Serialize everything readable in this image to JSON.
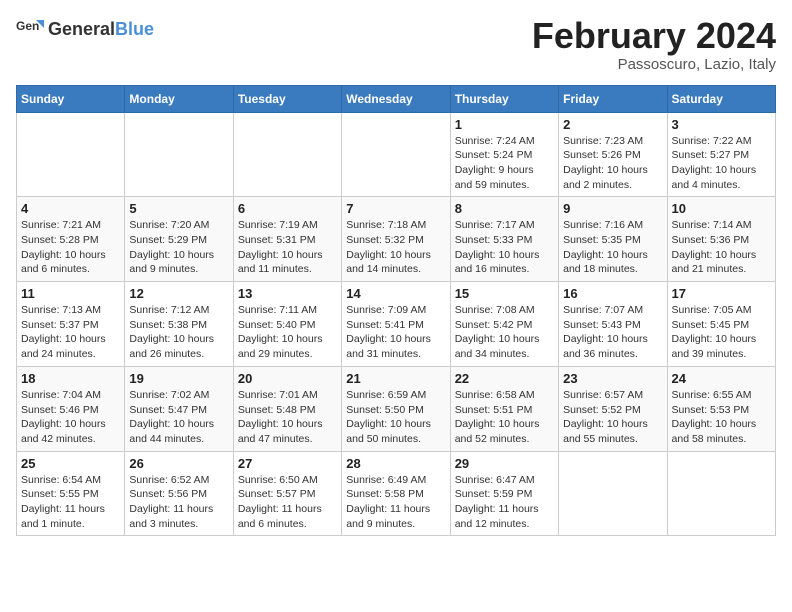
{
  "header": {
    "logo_line1": "General",
    "logo_line2": "Blue",
    "month_title": "February 2024",
    "subtitle": "Passoscuro, Lazio, Italy"
  },
  "weekdays": [
    "Sunday",
    "Monday",
    "Tuesday",
    "Wednesday",
    "Thursday",
    "Friday",
    "Saturday"
  ],
  "weeks": [
    [
      {
        "day": "",
        "info": ""
      },
      {
        "day": "",
        "info": ""
      },
      {
        "day": "",
        "info": ""
      },
      {
        "day": "",
        "info": ""
      },
      {
        "day": "1",
        "info": "Sunrise: 7:24 AM\nSunset: 5:24 PM\nDaylight: 9 hours\nand 59 minutes."
      },
      {
        "day": "2",
        "info": "Sunrise: 7:23 AM\nSunset: 5:26 PM\nDaylight: 10 hours\nand 2 minutes."
      },
      {
        "day": "3",
        "info": "Sunrise: 7:22 AM\nSunset: 5:27 PM\nDaylight: 10 hours\nand 4 minutes."
      }
    ],
    [
      {
        "day": "4",
        "info": "Sunrise: 7:21 AM\nSunset: 5:28 PM\nDaylight: 10 hours\nand 6 minutes."
      },
      {
        "day": "5",
        "info": "Sunrise: 7:20 AM\nSunset: 5:29 PM\nDaylight: 10 hours\nand 9 minutes."
      },
      {
        "day": "6",
        "info": "Sunrise: 7:19 AM\nSunset: 5:31 PM\nDaylight: 10 hours\nand 11 minutes."
      },
      {
        "day": "7",
        "info": "Sunrise: 7:18 AM\nSunset: 5:32 PM\nDaylight: 10 hours\nand 14 minutes."
      },
      {
        "day": "8",
        "info": "Sunrise: 7:17 AM\nSunset: 5:33 PM\nDaylight: 10 hours\nand 16 minutes."
      },
      {
        "day": "9",
        "info": "Sunrise: 7:16 AM\nSunset: 5:35 PM\nDaylight: 10 hours\nand 18 minutes."
      },
      {
        "day": "10",
        "info": "Sunrise: 7:14 AM\nSunset: 5:36 PM\nDaylight: 10 hours\nand 21 minutes."
      }
    ],
    [
      {
        "day": "11",
        "info": "Sunrise: 7:13 AM\nSunset: 5:37 PM\nDaylight: 10 hours\nand 24 minutes."
      },
      {
        "day": "12",
        "info": "Sunrise: 7:12 AM\nSunset: 5:38 PM\nDaylight: 10 hours\nand 26 minutes."
      },
      {
        "day": "13",
        "info": "Sunrise: 7:11 AM\nSunset: 5:40 PM\nDaylight: 10 hours\nand 29 minutes."
      },
      {
        "day": "14",
        "info": "Sunrise: 7:09 AM\nSunset: 5:41 PM\nDaylight: 10 hours\nand 31 minutes."
      },
      {
        "day": "15",
        "info": "Sunrise: 7:08 AM\nSunset: 5:42 PM\nDaylight: 10 hours\nand 34 minutes."
      },
      {
        "day": "16",
        "info": "Sunrise: 7:07 AM\nSunset: 5:43 PM\nDaylight: 10 hours\nand 36 minutes."
      },
      {
        "day": "17",
        "info": "Sunrise: 7:05 AM\nSunset: 5:45 PM\nDaylight: 10 hours\nand 39 minutes."
      }
    ],
    [
      {
        "day": "18",
        "info": "Sunrise: 7:04 AM\nSunset: 5:46 PM\nDaylight: 10 hours\nand 42 minutes."
      },
      {
        "day": "19",
        "info": "Sunrise: 7:02 AM\nSunset: 5:47 PM\nDaylight: 10 hours\nand 44 minutes."
      },
      {
        "day": "20",
        "info": "Sunrise: 7:01 AM\nSunset: 5:48 PM\nDaylight: 10 hours\nand 47 minutes."
      },
      {
        "day": "21",
        "info": "Sunrise: 6:59 AM\nSunset: 5:50 PM\nDaylight: 10 hours\nand 50 minutes."
      },
      {
        "day": "22",
        "info": "Sunrise: 6:58 AM\nSunset: 5:51 PM\nDaylight: 10 hours\nand 52 minutes."
      },
      {
        "day": "23",
        "info": "Sunrise: 6:57 AM\nSunset: 5:52 PM\nDaylight: 10 hours\nand 55 minutes."
      },
      {
        "day": "24",
        "info": "Sunrise: 6:55 AM\nSunset: 5:53 PM\nDaylight: 10 hours\nand 58 minutes."
      }
    ],
    [
      {
        "day": "25",
        "info": "Sunrise: 6:54 AM\nSunset: 5:55 PM\nDaylight: 11 hours\nand 1 minute."
      },
      {
        "day": "26",
        "info": "Sunrise: 6:52 AM\nSunset: 5:56 PM\nDaylight: 11 hours\nand 3 minutes."
      },
      {
        "day": "27",
        "info": "Sunrise: 6:50 AM\nSunset: 5:57 PM\nDaylight: 11 hours\nand 6 minutes."
      },
      {
        "day": "28",
        "info": "Sunrise: 6:49 AM\nSunset: 5:58 PM\nDaylight: 11 hours\nand 9 minutes."
      },
      {
        "day": "29",
        "info": "Sunrise: 6:47 AM\nSunset: 5:59 PM\nDaylight: 11 hours\nand 12 minutes."
      },
      {
        "day": "",
        "info": ""
      },
      {
        "day": "",
        "info": ""
      }
    ]
  ]
}
